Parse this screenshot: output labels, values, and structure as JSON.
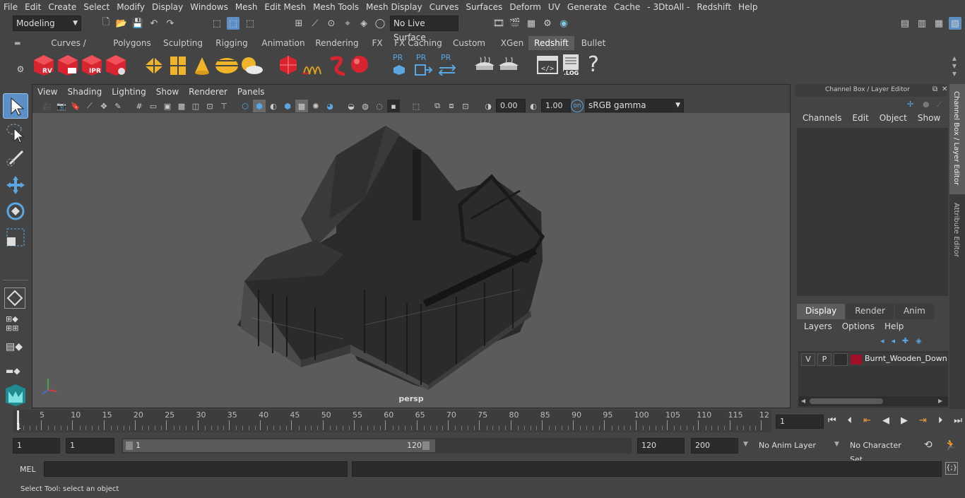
{
  "menu": [
    "File",
    "Edit",
    "Create",
    "Select",
    "Modify",
    "Display",
    "Windows",
    "Mesh",
    "Edit Mesh",
    "Mesh Tools",
    "Mesh Display",
    "Curves",
    "Surfaces",
    "Deform",
    "UV",
    "Generate",
    "Cache",
    "- 3DtoAll -",
    "Redshift",
    "Help"
  ],
  "status": {
    "mode": "Modeling",
    "live_surface": "No Live Surface"
  },
  "shelf_tabs": [
    "Curves / Surfaces",
    "Polygons",
    "Sculpting",
    "Rigging",
    "Animation",
    "Rendering",
    "FX",
    "FX Caching",
    "Custom",
    "XGen",
    "Redshift",
    "Bullet"
  ],
  "shelf_active": "Redshift",
  "shelf_labels": {
    "rv": "RV",
    "ipr": "IPR",
    "pr1": "PR",
    "pr2": "PR",
    "pr3": "PR",
    "log": ".LOG",
    "help": "?"
  },
  "viewport": {
    "menu": [
      "View",
      "Shading",
      "Lighting",
      "Show",
      "Renderer",
      "Panels"
    ],
    "exposure": "0.00",
    "gamma": "1.00",
    "colorspace": "sRGB gamma",
    "camera": "persp"
  },
  "channel_box": {
    "title": "Channel Box / Layer Editor",
    "menu": [
      "Channels",
      "Edit",
      "Object",
      "Show"
    ]
  },
  "layer_editor": {
    "tabs": [
      "Display",
      "Render",
      "Anim"
    ],
    "active_tab": "Display",
    "menu": [
      "Layers",
      "Options",
      "Help"
    ],
    "layer": {
      "v": "V",
      "p": "P",
      "name": "Burnt_Wooden_Down",
      "color": "#a0102a"
    }
  },
  "side_tabs": [
    "Channel Box / Layer Editor",
    "Attribute Editor"
  ],
  "timeline": {
    "ticks": [
      "5",
      "10",
      "15",
      "20",
      "25",
      "30",
      "35",
      "40",
      "45",
      "50",
      "55",
      "60",
      "65",
      "70",
      "75",
      "80",
      "85",
      "90",
      "95",
      "100",
      "105",
      "110",
      "115",
      "12"
    ],
    "current_marker": "1",
    "current_frame": "1"
  },
  "range": {
    "start": "1",
    "start2": "1",
    "slider_start": "1",
    "slider_end": "120",
    "end": "120",
    "end2": "200",
    "anim_layer": "No Anim Layer",
    "character_set": "No Character Set"
  },
  "cmd": {
    "label": "MEL"
  },
  "help": "Select Tool: select an object",
  "colors": {
    "accent": "#5d8fc7",
    "bg": "#444444",
    "viewport": "#5b5b5b",
    "redshift_red": "#d9232f",
    "gold": "#f0b429"
  }
}
